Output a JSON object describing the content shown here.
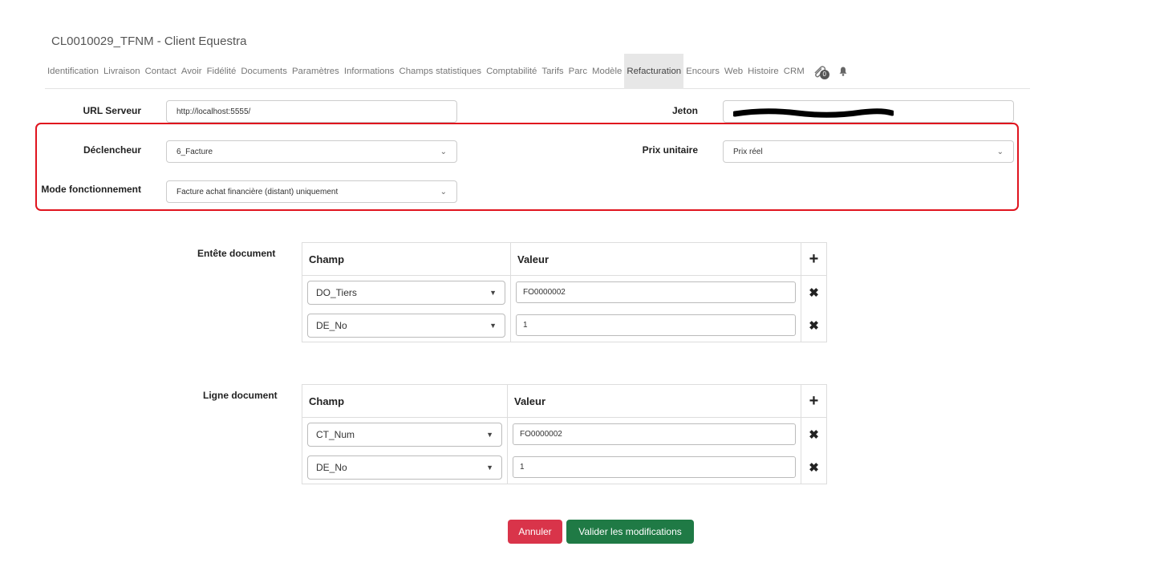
{
  "header": {
    "title": "CL0010029_TFNM - Client Equestra"
  },
  "tabs": [
    {
      "label": "Identification"
    },
    {
      "label": "Livraison"
    },
    {
      "label": "Contact"
    },
    {
      "label": "Avoir"
    },
    {
      "label": "Fidélité"
    },
    {
      "label": "Documents"
    },
    {
      "label": "Paramètres"
    },
    {
      "label": "Informations"
    },
    {
      "label": "Champs statistiques"
    },
    {
      "label": "Comptabilité"
    },
    {
      "label": "Tarifs"
    },
    {
      "label": "Parc"
    },
    {
      "label": "Modèle"
    },
    {
      "label": "Refacturation",
      "active": true
    },
    {
      "label": "Encours"
    },
    {
      "label": "Web"
    },
    {
      "label": "Histoire"
    },
    {
      "label": "CRM"
    }
  ],
  "tab_icons": {
    "attachments_icon": "paperclip-icon",
    "attachments_count": "0",
    "notifications_icon": "bell-icon"
  },
  "form": {
    "url_label": "URL Serveur",
    "url_value": "http://localhost:5555/",
    "jeton_label": "Jeton",
    "declencheur_label": "Déclencheur",
    "declencheur_value": "6_Facture",
    "prix_label": "Prix unitaire",
    "prix_value": "Prix réel",
    "mode_label": "Mode fonctionnement",
    "mode_value": "Facture achat financière (distant) uniquement"
  },
  "entete": {
    "label": "Entête document",
    "col_champ": "Champ",
    "col_valeur": "Valeur",
    "rows": [
      {
        "champ": "DO_Tiers",
        "valeur": "FO0000002"
      },
      {
        "champ": "DE_No",
        "valeur": "1"
      }
    ]
  },
  "ligne": {
    "label": "Ligne document",
    "col_champ": "Champ",
    "col_valeur": "Valeur",
    "rows": [
      {
        "champ": "CT_Num",
        "valeur": "FO0000002"
      },
      {
        "champ": "DE_No",
        "valeur": "1"
      }
    ]
  },
  "actions": {
    "cancel_label": "Annuler",
    "save_label": "Valider les modifications"
  },
  "colors": {
    "highlight": "#e0141e",
    "cancel": "#d9344a",
    "save": "#1f7a45",
    "active_tab": "#e7e7e7"
  }
}
